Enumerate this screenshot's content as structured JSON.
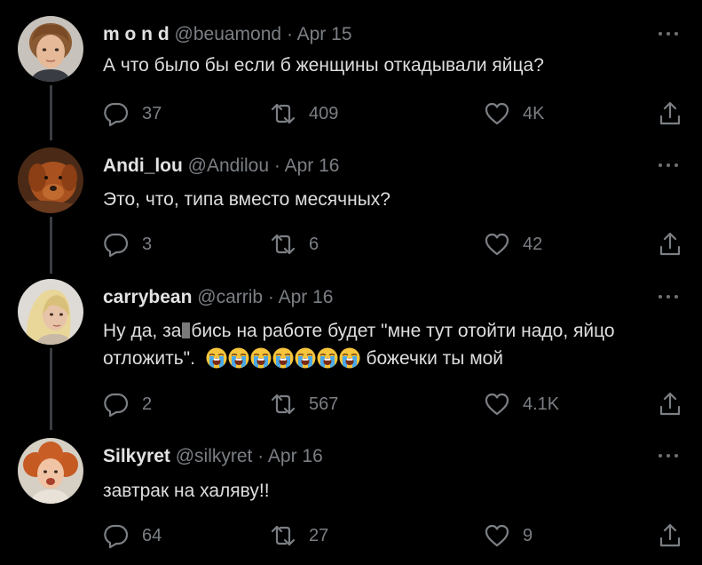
{
  "colors": {
    "background": "#000000",
    "text": "#dedede",
    "secondary": "#7b7f84",
    "thread_line": "#3a3d41"
  },
  "tweets": [
    {
      "name": "m o n d",
      "handle": "@beuamond",
      "separator": "·",
      "date": "Apr 15",
      "text": "А что было бы если б женщины откадывали яйца?",
      "replies": "37",
      "retweets": "409",
      "likes": "4K"
    },
    {
      "name": "Andi_lou",
      "handle": "@Andilou",
      "separator": "·",
      "date": "Apr 16",
      "text": "Это, что, типа вместо месячных?",
      "replies": "3",
      "retweets": "6",
      "likes": "42"
    },
    {
      "name": "carrybean",
      "handle": "@carrib",
      "separator": "·",
      "date": "Apr 16",
      "text_line1_a": "Ну да, за",
      "text_line1_b": "бись на работе будет \"мне тут отойти надо, яйцо",
      "text_line2_a": "отложить\".",
      "text_line2_b": "божечки ты мой",
      "emoji_name": "loudly-crying-face",
      "emoji_count": 7,
      "replies": "2",
      "retweets": "567",
      "likes": "4.1K"
    },
    {
      "name": "Silkyret",
      "handle": "@silkyret",
      "separator": "·",
      "date": "Apr 16",
      "text": "завтрак на халяву!!",
      "replies": "64",
      "retweets": "27",
      "likes": "9"
    }
  ]
}
